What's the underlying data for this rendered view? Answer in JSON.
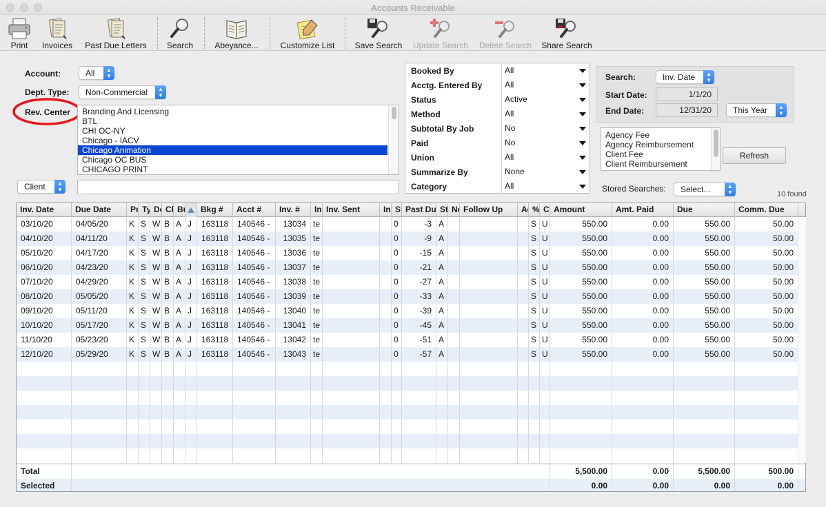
{
  "window": {
    "title": "Accounts Receivable"
  },
  "toolbar": {
    "print": "Print",
    "invoices": "Invoices",
    "past_due_letters": "Past Due Letters",
    "search": "Search",
    "abeyance": "Abeyance...",
    "customize_list": "Customize List",
    "save_search": "Save Search",
    "update_search": "Update Search",
    "delete_search": "Delete Search",
    "share_search": "Share Search"
  },
  "filters": {
    "account_label": "Account:",
    "account_value": "All",
    "dept_type_label": "Dept. Type:",
    "dept_type_value": "Non-Commercial",
    "rev_center_label": "Rev. Center",
    "rev_centers": [
      "Branding And Licensing",
      "BTL",
      "CHI OC-NY",
      "Chicago - IACV",
      "Chicago Animation",
      "Chicago OC BUS",
      "CHICAGO PRINT"
    ],
    "rev_center_selected": "Chicago Animation",
    "client_popup": "Client",
    "client_value": ""
  },
  "criteria": [
    {
      "label": "Booked By",
      "value": "All"
    },
    {
      "label": "Acctg. Entered By",
      "value": "All"
    },
    {
      "label": "Status",
      "value": "Active"
    },
    {
      "label": "Method",
      "value": "All"
    },
    {
      "label": "Subtotal By Job",
      "value": "No"
    },
    {
      "label": "Paid",
      "value": "No"
    },
    {
      "label": "Union",
      "value": "All"
    },
    {
      "label": "Summarize By",
      "value": "None"
    },
    {
      "label": "Category",
      "value": "All"
    }
  ],
  "search_panel": {
    "search_label": "Search:",
    "search_value": "Inv. Date",
    "start_label": "Start Date:",
    "start_value": "1/1/20",
    "end_label": "End Date:",
    "end_value": "12/31/20",
    "range_value": "This Year"
  },
  "fee_types": [
    "Agency Fee",
    "Agency Reimbursement",
    "Client Fee",
    "Client Reimbursement"
  ],
  "refresh_button": "Refresh",
  "stored_searches": {
    "label": "Stored Searches:",
    "value": "Select..."
  },
  "found_count": "10 found",
  "table": {
    "sort_icon": "sort-ascending-icon",
    "headers": [
      "Inv. Date",
      "Due Date",
      "Pr",
      "Ty",
      "De",
      "Cl",
      "Bu",
      "",
      "Bkg #",
      "Acct #",
      "Inv. #",
      "In",
      "Inv. Sent",
      "In",
      "St",
      "Past Du",
      "St",
      "Ne",
      "Follow Up",
      "Ac",
      "%",
      "Cu",
      "Amount",
      "Amt. Paid",
      "Due",
      "Comm. Due"
    ],
    "rows": [
      [
        "03/10/20",
        "04/05/20",
        "K",
        "S",
        "W",
        "B",
        "A",
        "J",
        "163118",
        "140546 -",
        "13034",
        "te",
        "",
        "",
        "0",
        "-3",
        "A",
        "",
        "",
        "",
        "S",
        "U",
        "550.00",
        "0.00",
        "550.00",
        "50.00"
      ],
      [
        "04/10/20",
        "04/11/20",
        "K",
        "S",
        "W",
        "B",
        "A",
        "J",
        "163118",
        "140546 -",
        "13035",
        "te",
        "",
        "",
        "0",
        "-9",
        "A",
        "",
        "",
        "",
        "S",
        "U",
        "550.00",
        "0.00",
        "550.00",
        "50.00"
      ],
      [
        "05/10/20",
        "04/17/20",
        "K",
        "S",
        "W",
        "B",
        "A",
        "J",
        "163118",
        "140546 -",
        "13036",
        "te",
        "",
        "",
        "0",
        "-15",
        "A",
        "",
        "",
        "",
        "S",
        "U",
        "550.00",
        "0.00",
        "550.00",
        "50.00"
      ],
      [
        "06/10/20",
        "04/23/20",
        "K",
        "S",
        "W",
        "B",
        "A",
        "J",
        "163118",
        "140546 -",
        "13037",
        "te",
        "",
        "",
        "0",
        "-21",
        "A",
        "",
        "",
        "",
        "S",
        "U",
        "550.00",
        "0.00",
        "550.00",
        "50.00"
      ],
      [
        "07/10/20",
        "04/29/20",
        "K",
        "S",
        "W",
        "B",
        "A",
        "J",
        "163118",
        "140546 -",
        "13038",
        "te",
        "",
        "",
        "0",
        "-27",
        "A",
        "",
        "",
        "",
        "S",
        "U",
        "550.00",
        "0.00",
        "550.00",
        "50.00"
      ],
      [
        "08/10/20",
        "05/05/20",
        "K",
        "S",
        "W",
        "B",
        "A",
        "J",
        "163118",
        "140546 -",
        "13039",
        "te",
        "",
        "",
        "0",
        "-33",
        "A",
        "",
        "",
        "",
        "S",
        "U",
        "550.00",
        "0.00",
        "550.00",
        "50.00"
      ],
      [
        "09/10/20",
        "05/11/20",
        "K",
        "S",
        "W",
        "B",
        "A",
        "J",
        "163118",
        "140546 -",
        "13040",
        "te",
        "",
        "",
        "0",
        "-39",
        "A",
        "",
        "",
        "",
        "S",
        "U",
        "550.00",
        "0.00",
        "550.00",
        "50.00"
      ],
      [
        "10/10/20",
        "05/17/20",
        "K",
        "S",
        "W",
        "B",
        "A",
        "J",
        "163118",
        "140546 -",
        "13041",
        "te",
        "",
        "",
        "0",
        "-45",
        "A",
        "",
        "",
        "",
        "S",
        "U",
        "550.00",
        "0.00",
        "550.00",
        "50.00"
      ],
      [
        "11/10/20",
        "05/23/20",
        "K",
        "S",
        "W",
        "B",
        "A",
        "J",
        "163118",
        "140546 -",
        "13042",
        "te",
        "",
        "",
        "0",
        "-51",
        "A",
        "",
        "",
        "",
        "S",
        "U",
        "550.00",
        "0.00",
        "550.00",
        "50.00"
      ],
      [
        "12/10/20",
        "05/29/20",
        "K",
        "S",
        "W",
        "B",
        "A",
        "J",
        "163118",
        "140546 -",
        "13043",
        "te",
        "",
        "",
        "0",
        "-57",
        "A",
        "",
        "",
        "",
        "S",
        "U",
        "550.00",
        "0.00",
        "550.00",
        "50.00"
      ]
    ],
    "total": {
      "label": "Total",
      "amount": "5,500.00",
      "amt_paid": "0.00",
      "due": "5,500.00",
      "comm_due": "500.00"
    },
    "selected": {
      "label": "Selected",
      "amount": "0.00",
      "amt_paid": "0.00",
      "due": "0.00",
      "comm_due": "0.00"
    }
  },
  "colors": {
    "selection": "#0a46d4",
    "highlight_circle": "#e8141a",
    "row_alt": "#e8eef8"
  }
}
